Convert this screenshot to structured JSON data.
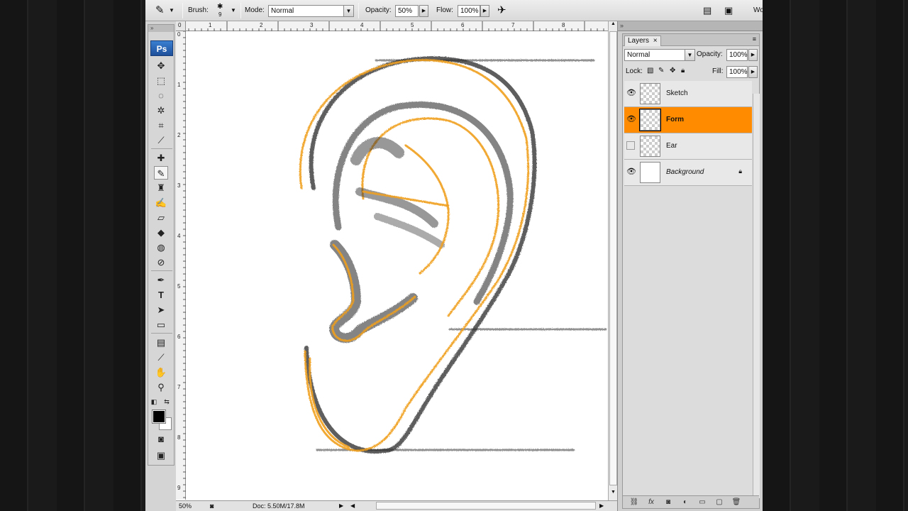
{
  "options_bar": {
    "brush_label": "Brush:",
    "brush_size": "9",
    "mode_label": "Mode:",
    "mode_value": "Normal",
    "opacity_label": "Opacity:",
    "opacity_value": "50%",
    "flow_label": "Flow:",
    "flow_value": "100%",
    "workspace_label": "Wo"
  },
  "toolbox": {
    "logo": "Ps",
    "tools": [
      "move",
      "marquee",
      "lasso",
      "magic-wand",
      "crop",
      "eyedropper",
      "healing",
      "brush",
      "clone-stamp",
      "history-brush",
      "eraser",
      "paint-bucket",
      "blur",
      "dodge",
      "pen",
      "type",
      "path-selection",
      "rectangle",
      "notes",
      "color-sampler",
      "hand",
      "zoom"
    ],
    "active_tool": "brush"
  },
  "rulers": {
    "horizontal": [
      "0",
      "1",
      "2",
      "3",
      "4",
      "5",
      "6",
      "7",
      "8"
    ],
    "vertical": [
      "0",
      "1",
      "2",
      "3",
      "4",
      "5",
      "6",
      "7",
      "8",
      "9"
    ]
  },
  "status": {
    "zoom": "50%",
    "doc": "Doc: 5.50M/17.8M"
  },
  "layers_panel": {
    "tab_title": "Layers",
    "blend_mode": "Normal",
    "opacity_label": "Opacity:",
    "opacity_value": "100%",
    "lock_label": "Lock:",
    "fill_label": "Fill:",
    "fill_value": "100%",
    "layers": [
      {
        "name": "Sketch",
        "visible": true
      },
      {
        "name": "Form",
        "visible": true,
        "selected": true
      },
      {
        "name": "Ear",
        "visible": false
      },
      {
        "name": "Background",
        "visible": true,
        "locked": true
      }
    ]
  },
  "colors": {
    "selection": "#ff8c00",
    "sketch_orange": "#f0a020",
    "sketch_dark": "#2a2a2a"
  }
}
